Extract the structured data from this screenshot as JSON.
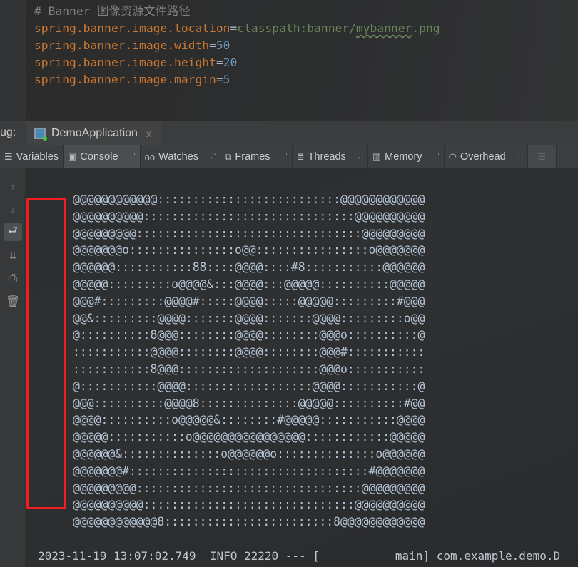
{
  "editor": {
    "comment": "# Banner 图像资源文件路径",
    "lines": [
      {
        "key": "spring.banner.image.location",
        "value": "classpath:banner/",
        "value_squiggle": "mybanner",
        "value_tail": ".png"
      },
      {
        "key": "spring.banner.image.width",
        "value": "50"
      },
      {
        "key": "spring.banner.image.height",
        "value": "20"
      },
      {
        "key": "spring.banner.image.margin",
        "value": "5"
      }
    ],
    "eq": "="
  },
  "debug": {
    "label": "ug:",
    "run_tab": "DemoApplication",
    "close": "x"
  },
  "tool_tabs": [
    {
      "label": "Variables",
      "icon": "variables-icon"
    },
    {
      "label": "Console",
      "icon": "console-icon",
      "active": true
    },
    {
      "label": "Watches",
      "icon": "watches-icon"
    },
    {
      "label": "Frames",
      "icon": "frames-icon"
    },
    {
      "label": "Threads",
      "icon": "threads-icon"
    },
    {
      "label": "Memory",
      "icon": "memory-icon"
    },
    {
      "label": "Overhead",
      "icon": "overhead-icon"
    }
  ],
  "left_toolbar": [
    "up-arrow-icon",
    "down-arrow-icon",
    "soft-wrap-icon",
    "scroll-to-end-icon",
    "print-icon",
    "trash-icon"
  ],
  "banner": [
    "@@@@@@@@@@@@::::::::::::::::::::::::::@@@@@@@@@@@@",
    "@@@@@@@@@@::::::::::::::::::::::::::::::@@@@@@@@@@",
    "@@@@@@@@@::::::::::::::::::::::::::::::::@@@@@@@@@",
    "@@@@@@@o:::::::::::::::o@@::::::::::::::::o@@@@@@@",
    "@@@@@@:::::::::::88::::@@@@::::#8:::::::::::@@@@@@",
    "@@@@@:::::::::o@@@@&:::@@@@:::@@@@@::::::::::@@@@@",
    "@@@#:::::::::@@@@#:::::@@@@:::::@@@@@:::::::::#@@@",
    "@@&:::::::::@@@@:::::::@@@@:::::::@@@@:::::::::o@@",
    "@::::::::::8@@@::::::::@@@@::::::::@@@o::::::::::@",
    ":::::::::::@@@@::::::::@@@@::::::::@@@#:::::::::::",
    ":::::::::::8@@@::::::::::::::::::::@@@o:::::::::::",
    "@:::::::::::@@@@::::::::::::::::::@@@@:::::::::::@",
    "@@@::::::::::@@@@8::::::::::::::@@@@@::::::::::#@@",
    "@@@@::::::::::o@@@@@&::::::::#@@@@@:::::::::::@@@@",
    "@@@@@:::::::::::o@@@@@@@@@@@@@@@@::::::::::::@@@@@",
    "@@@@@@&::::::::::::::o@@@@@@o::::::::::::::o@@@@@@",
    "@@@@@@@#::::::::::::::::::::::::::::::::::#@@@@@@@",
    "@@@@@@@@@::::::::::::::::::::::::::::::::@@@@@@@@@",
    "@@@@@@@@@@::::::::::::::::::::::::::::::@@@@@@@@@@",
    "@@@@@@@@@@@@8::::::::::::::::::::::::8@@@@@@@@@@@@"
  ],
  "log_line": "2023-11-19 13:07:02.749  INFO 22220 --- [           main] com.example.demo.D",
  "colors": {
    "highlight_box": "#f01e1e",
    "key": "#cc7832",
    "string": "#6a8759",
    "number": "#6897bb"
  }
}
